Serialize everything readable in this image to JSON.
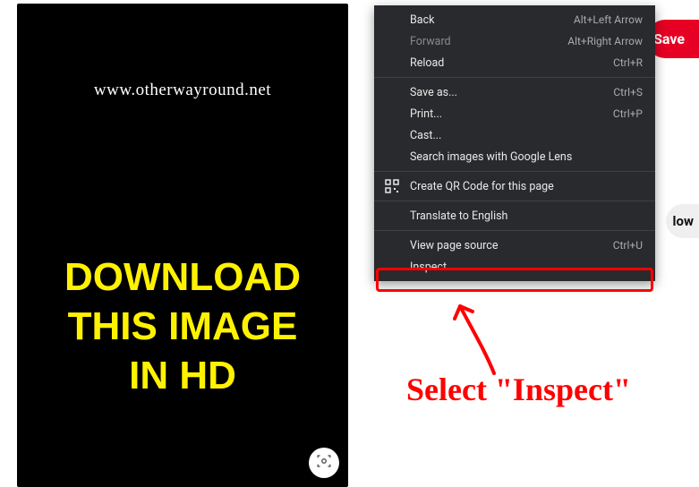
{
  "image_panel": {
    "watermark": "www.otherwayround.net",
    "headline_line1": "DOWNLOAD",
    "headline_line2": "THIS IMAGE",
    "headline_line3": "IN HD"
  },
  "buttons": {
    "save": "Save",
    "follow": "low"
  },
  "context_menu": {
    "back": {
      "label": "Back",
      "shortcut": "Alt+Left Arrow"
    },
    "forward": {
      "label": "Forward",
      "shortcut": "Alt+Right Arrow"
    },
    "reload": {
      "label": "Reload",
      "shortcut": "Ctrl+R"
    },
    "save_as": {
      "label": "Save as...",
      "shortcut": "Ctrl+S"
    },
    "print": {
      "label": "Print...",
      "shortcut": "Ctrl+P"
    },
    "cast": {
      "label": "Cast..."
    },
    "search_lens": {
      "label": "Search images with Google Lens"
    },
    "qr_code": {
      "label": "Create QR Code for this page"
    },
    "translate": {
      "label": "Translate to English"
    },
    "view_source": {
      "label": "View page source",
      "shortcut": "Ctrl+U"
    },
    "inspect": {
      "label": "Inspect"
    }
  },
  "annotation": {
    "text": "Select \"Inspect\""
  }
}
